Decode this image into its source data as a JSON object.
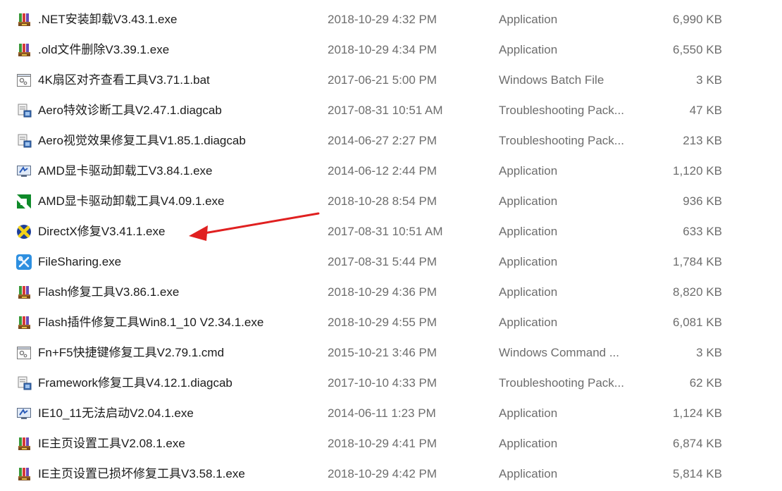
{
  "files": [
    {
      "name": ".NET安装卸载V3.43.1.exe",
      "date": "2018-10-29 4:32 PM",
      "type": "Application",
      "size": "6,990 KB",
      "icon": "installer-icon"
    },
    {
      "name": ".old文件删除V3.39.1.exe",
      "date": "2018-10-29 4:34 PM",
      "type": "Application",
      "size": "6,550 KB",
      "icon": "installer-icon"
    },
    {
      "name": "4K扇区对齐查看工具V3.71.1.bat",
      "date": "2017-06-21 5:00 PM",
      "type": "Windows Batch File",
      "size": "3 KB",
      "icon": "batch-file-icon"
    },
    {
      "name": "Aero特效诊断工具V2.47.1.diagcab",
      "date": "2017-08-31 10:51 AM",
      "type": "Troubleshooting Pack...",
      "size": "47 KB",
      "icon": "diagcab-icon"
    },
    {
      "name": "Aero视觉效果修复工具V1.85.1.diagcab",
      "date": "2014-06-27 2:27 PM",
      "type": "Troubleshooting Pack...",
      "size": "213 KB",
      "icon": "diagcab-icon"
    },
    {
      "name": "AMD显卡驱动卸载工V3.84.1.exe",
      "date": "2014-06-12 2:44 PM",
      "type": "Application",
      "size": "1,120 KB",
      "icon": "monitor-icon"
    },
    {
      "name": "AMD显卡驱动卸载工具V4.09.1.exe",
      "date": "2018-10-28 8:54 PM",
      "type": "Application",
      "size": "936 KB",
      "icon": "amd-logo-icon"
    },
    {
      "name": "DirectX修复V3.41.1.exe",
      "date": "2017-08-31 10:51 AM",
      "type": "Application",
      "size": "633 KB",
      "icon": "directx-icon"
    },
    {
      "name": "FileSharing.exe",
      "date": "2017-08-31 5:44 PM",
      "type": "Application",
      "size": "1,784 KB",
      "icon": "tools-icon"
    },
    {
      "name": "Flash修复工具V3.86.1.exe",
      "date": "2018-10-29 4:36 PM",
      "type": "Application",
      "size": "8,820 KB",
      "icon": "installer-icon"
    },
    {
      "name": "Flash插件修复工具Win8.1_10 V2.34.1.exe",
      "date": "2018-10-29 4:55 PM",
      "type": "Application",
      "size": "6,081 KB",
      "icon": "installer-icon"
    },
    {
      "name": "Fn+F5快捷键修复工具V2.79.1.cmd",
      "date": "2015-10-21 3:46 PM",
      "type": "Windows Command ...",
      "size": "3 KB",
      "icon": "batch-file-icon"
    },
    {
      "name": "Framework修复工具V4.12.1.diagcab",
      "date": "2017-10-10 4:33 PM",
      "type": "Troubleshooting Pack...",
      "size": "62 KB",
      "icon": "diagcab-icon"
    },
    {
      "name": "IE10_11无法启动V2.04.1.exe",
      "date": "2014-06-11 1:23 PM",
      "type": "Application",
      "size": "1,124 KB",
      "icon": "monitor-icon"
    },
    {
      "name": "IE主页设置工具V2.08.1.exe",
      "date": "2018-10-29 4:41 PM",
      "type": "Application",
      "size": "6,874 KB",
      "icon": "installer-icon"
    },
    {
      "name": "IE主页设置已损坏修复工具V3.58.1.exe",
      "date": "2018-10-29 4:42 PM",
      "type": "Application",
      "size": "5,814 KB",
      "icon": "installer-icon"
    }
  ],
  "annotation_color": "#e02020"
}
